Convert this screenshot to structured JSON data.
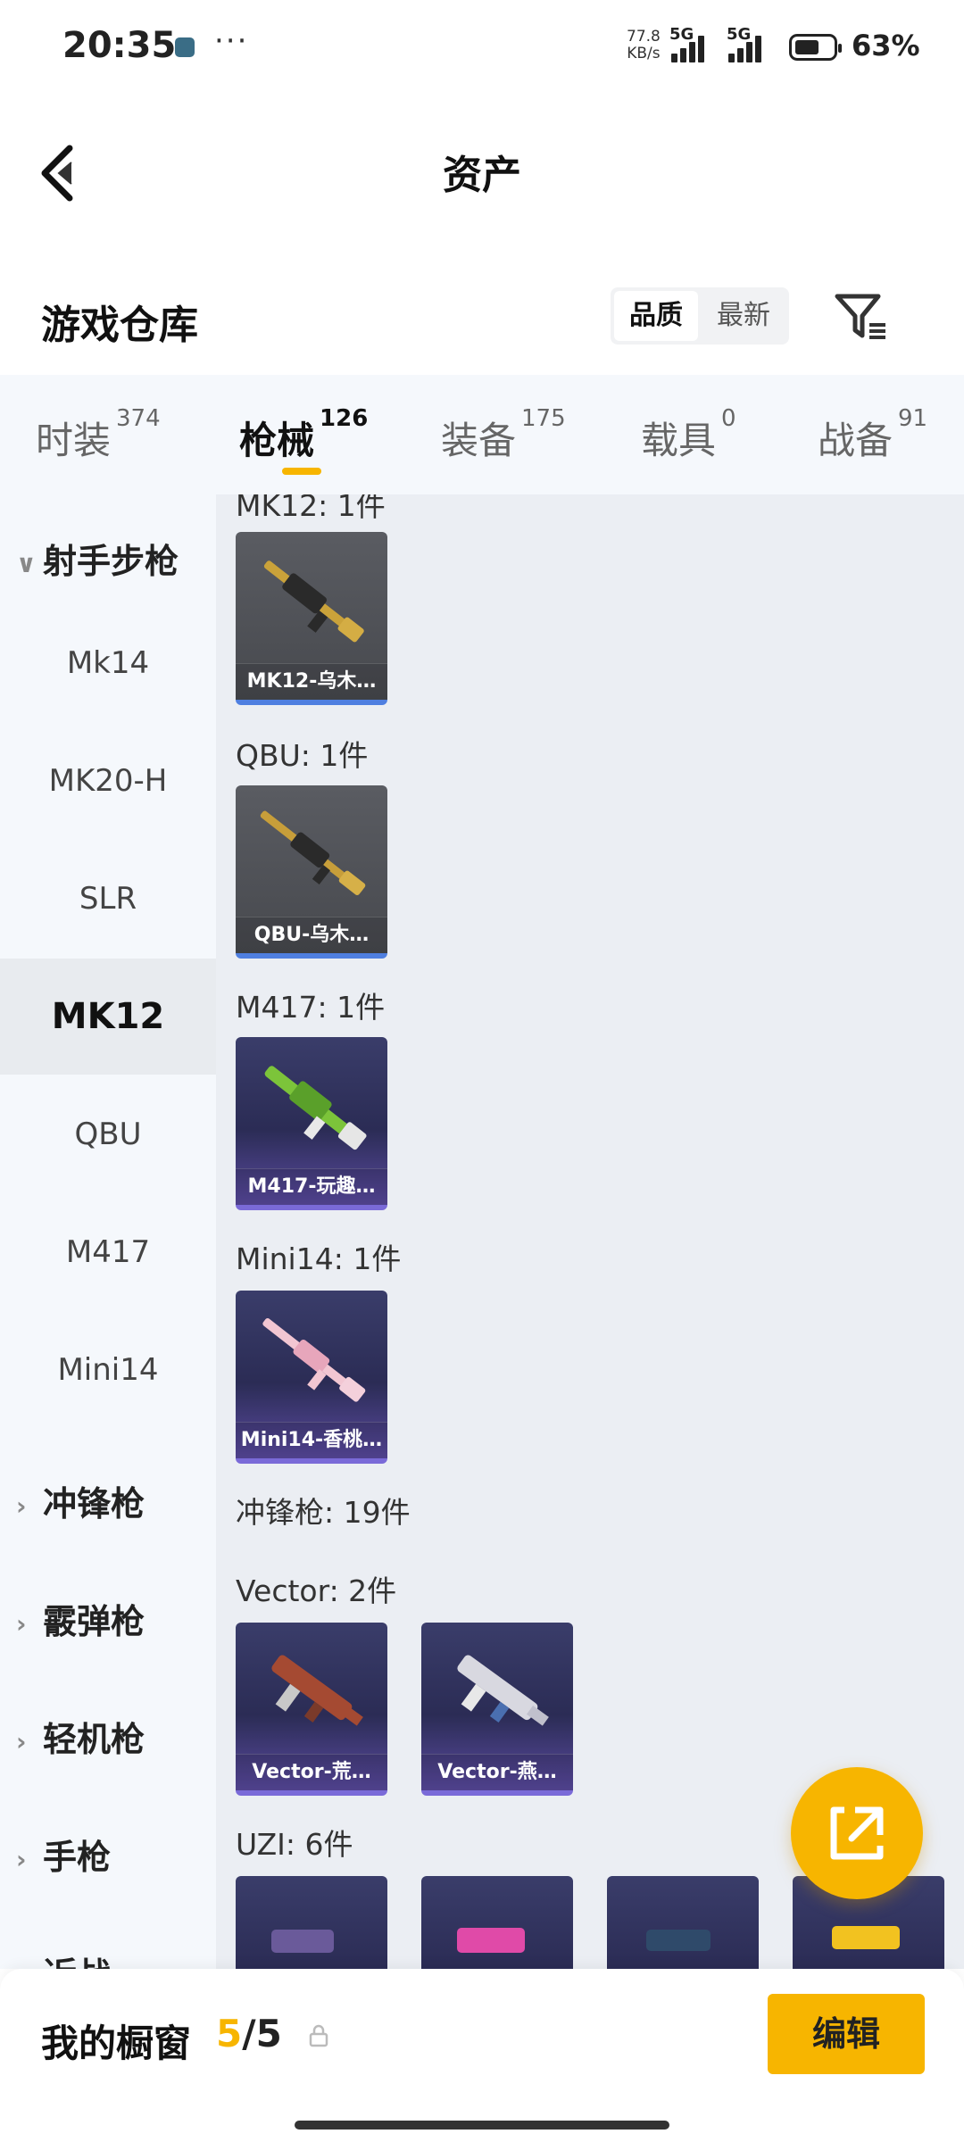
{
  "status_bar": {
    "time": "20:35",
    "speed_value": "77.8",
    "speed_unit": "KB/s",
    "network1": "5G",
    "network2": "5G",
    "battery_pct": "63%"
  },
  "nav": {
    "title": "资产"
  },
  "warehouse": {
    "title": "游戏仓库",
    "sort_options": [
      "品质",
      "最新"
    ],
    "active_sort": "品质"
  },
  "tabs": [
    {
      "label": "时装",
      "count": "374"
    },
    {
      "label": "枪械",
      "count": "126"
    },
    {
      "label": "装备",
      "count": "175"
    },
    {
      "label": "载具",
      "count": "0"
    },
    {
      "label": "战备",
      "count": "91"
    }
  ],
  "active_tab": "枪械",
  "sidebar": {
    "category_open": "射手步枪",
    "items": [
      "Mk14",
      "MK20-H",
      "SLR",
      "MK12",
      "QBU",
      "M417",
      "Mini14"
    ],
    "active_item": "MK12",
    "categories_closed": [
      "冲锋枪",
      "霰弹枪",
      "轻机枪",
      "手枪",
      "近战"
    ]
  },
  "content": {
    "partial_top_label": "MK12: 1件",
    "groups": [
      {
        "label": "QBU: 1件"
      },
      {
        "label": "M417: 1件"
      },
      {
        "label": "Mini14: 1件"
      },
      {
        "label": "冲锋枪: 19件"
      },
      {
        "label": "Vector: 2件"
      },
      {
        "label": "UZI: 6件"
      }
    ],
    "cards": [
      {
        "name": "MK12-乌木…"
      },
      {
        "name": "QBU-乌木…"
      },
      {
        "name": "M417-玩趣…"
      },
      {
        "name": "Mini14-香桃…"
      },
      {
        "name": "Vector-荒…"
      },
      {
        "name": "Vector-燕…"
      }
    ]
  },
  "bottom_bar": {
    "label": "我的橱窗",
    "current": "5",
    "total": "/5",
    "edit_label": "编辑"
  },
  "colors": {
    "accent": "#f7b500",
    "quality_blue": "#4f7fe0",
    "quality_purple": "#7a6ad8"
  }
}
